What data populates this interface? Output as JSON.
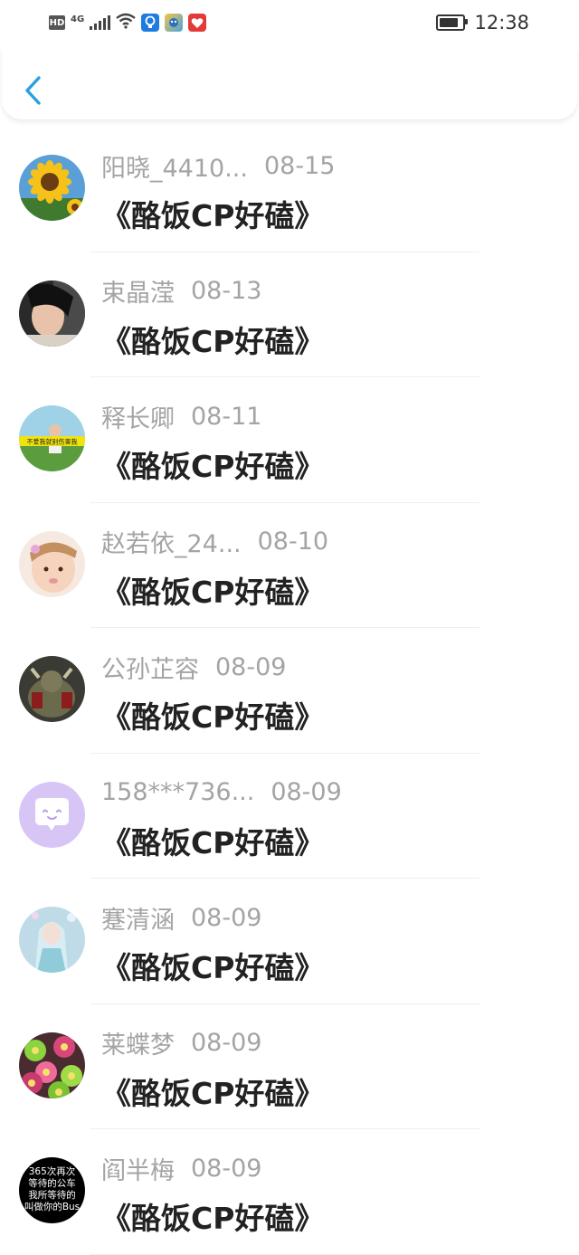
{
  "status_bar": {
    "hd_badge": "HD",
    "network_type": "4G",
    "time": "12:38",
    "battery_level": 0.8,
    "icons": [
      "hd-icon",
      "signal-icon",
      "wifi-icon",
      "bulb-app-icon",
      "game-app-icon",
      "heart-app-icon",
      "battery-icon"
    ]
  },
  "header": {
    "back_icon": "chevron-left-icon",
    "accent_color": "#2a9fe0"
  },
  "items": [
    {
      "name": "阳晓_4410...",
      "date": "08-15",
      "title": "《酪饭CP好磕》",
      "avatar": "sunflower"
    },
    {
      "name": "束晶滢",
      "date": "08-13",
      "title": "《酪饭CP好磕》",
      "avatar": "portrait"
    },
    {
      "name": "释长卿",
      "date": "08-11",
      "title": "《酪饭CP好磕》",
      "avatar": "scene",
      "avatar_text": "不爱我就别伤害我"
    },
    {
      "name": "赵若依_24...",
      "date": "08-10",
      "title": "《酪饭CP好磕》",
      "avatar": "baby"
    },
    {
      "name": "公孙芷容",
      "date": "08-09",
      "title": "《酪饭CP好磕》",
      "avatar": "warrior"
    },
    {
      "name": "158***736...",
      "date": "08-09",
      "title": "《酪饭CP好磕》",
      "avatar": "default"
    },
    {
      "name": "蹇清涵",
      "date": "08-09",
      "title": "《酪饭CP好磕》",
      "avatar": "doll"
    },
    {
      "name": "莱蝶梦",
      "date": "08-09",
      "title": "《酪饭CP好磕》",
      "avatar": "flowers"
    },
    {
      "name": "阎半梅",
      "date": "08-09",
      "title": "《酪饭CP好磕》",
      "avatar": "text",
      "avatar_lines": [
        "365次再次",
        "等待的公车",
        "我所等待的",
        "叫做你的Bus"
      ]
    }
  ]
}
